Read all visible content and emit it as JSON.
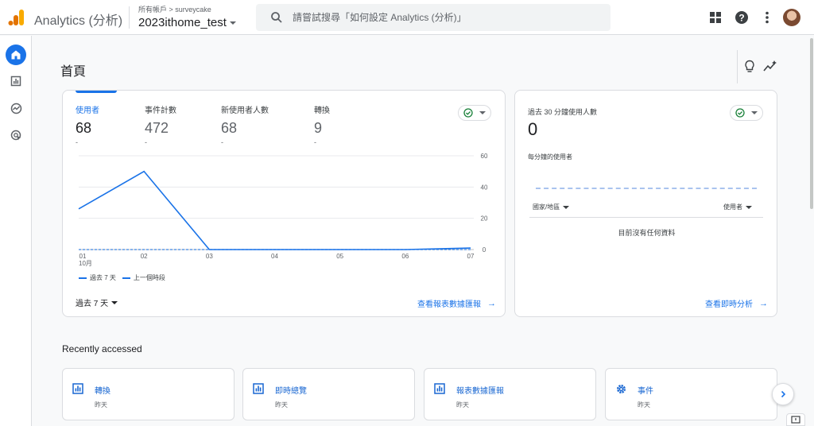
{
  "app": {
    "title": "Analytics (分析)"
  },
  "account": {
    "breadcrumb": "所有帳戶 > surveycake",
    "property": "2023ithome_test"
  },
  "search": {
    "placeholder": "請嘗試搜尋「如何設定 Analytics (分析)」"
  },
  "page": {
    "title": "首頁"
  },
  "metrics": [
    {
      "label": "使用者",
      "value": "68",
      "delta": "-"
    },
    {
      "label": "事件計數",
      "value": "472",
      "delta": "-"
    },
    {
      "label": "新使用者人數",
      "value": "68",
      "delta": "-"
    },
    {
      "label": "轉換",
      "value": "9",
      "delta": "-"
    }
  ],
  "chart_data": {
    "type": "line",
    "categories": [
      "01",
      "02",
      "03",
      "04",
      "05",
      "06",
      "07"
    ],
    "x_sublabel": "10月",
    "series": [
      {
        "name": "過去 7 天",
        "values": [
          26,
          50,
          0,
          0,
          0,
          0,
          1
        ]
      },
      {
        "name": "上一個時段",
        "values": [
          0,
          0,
          0,
          0,
          0,
          0,
          0
        ]
      }
    ],
    "y_ticks": [
      "0",
      "20",
      "40",
      "60"
    ],
    "ylim": [
      0,
      60
    ],
    "grid": true,
    "legend_position": "bottom-left",
    "colors": {
      "primary": "#1a73e8"
    }
  },
  "main_card": {
    "range_label": "過去 7 天",
    "link": "查看報表數據匯報"
  },
  "realtime": {
    "title": "過去 30 分鐘使用人數",
    "value": "0",
    "subtitle": "每分鐘的使用者",
    "col_country": "國家/地區",
    "col_users": "使用者",
    "empty": "目前沒有任何資料",
    "link": "查看即時分析"
  },
  "recent": {
    "title": "Recently accessed",
    "items": [
      {
        "label": "轉換",
        "sub": "昨天",
        "icon": "report-icon"
      },
      {
        "label": "即時總覽",
        "sub": "昨天",
        "icon": "report-icon"
      },
      {
        "label": "報表數據匯報",
        "sub": "昨天",
        "icon": "report-icon"
      },
      {
        "label": "事件",
        "sub": "昨天",
        "icon": "gear-icon"
      }
    ]
  }
}
